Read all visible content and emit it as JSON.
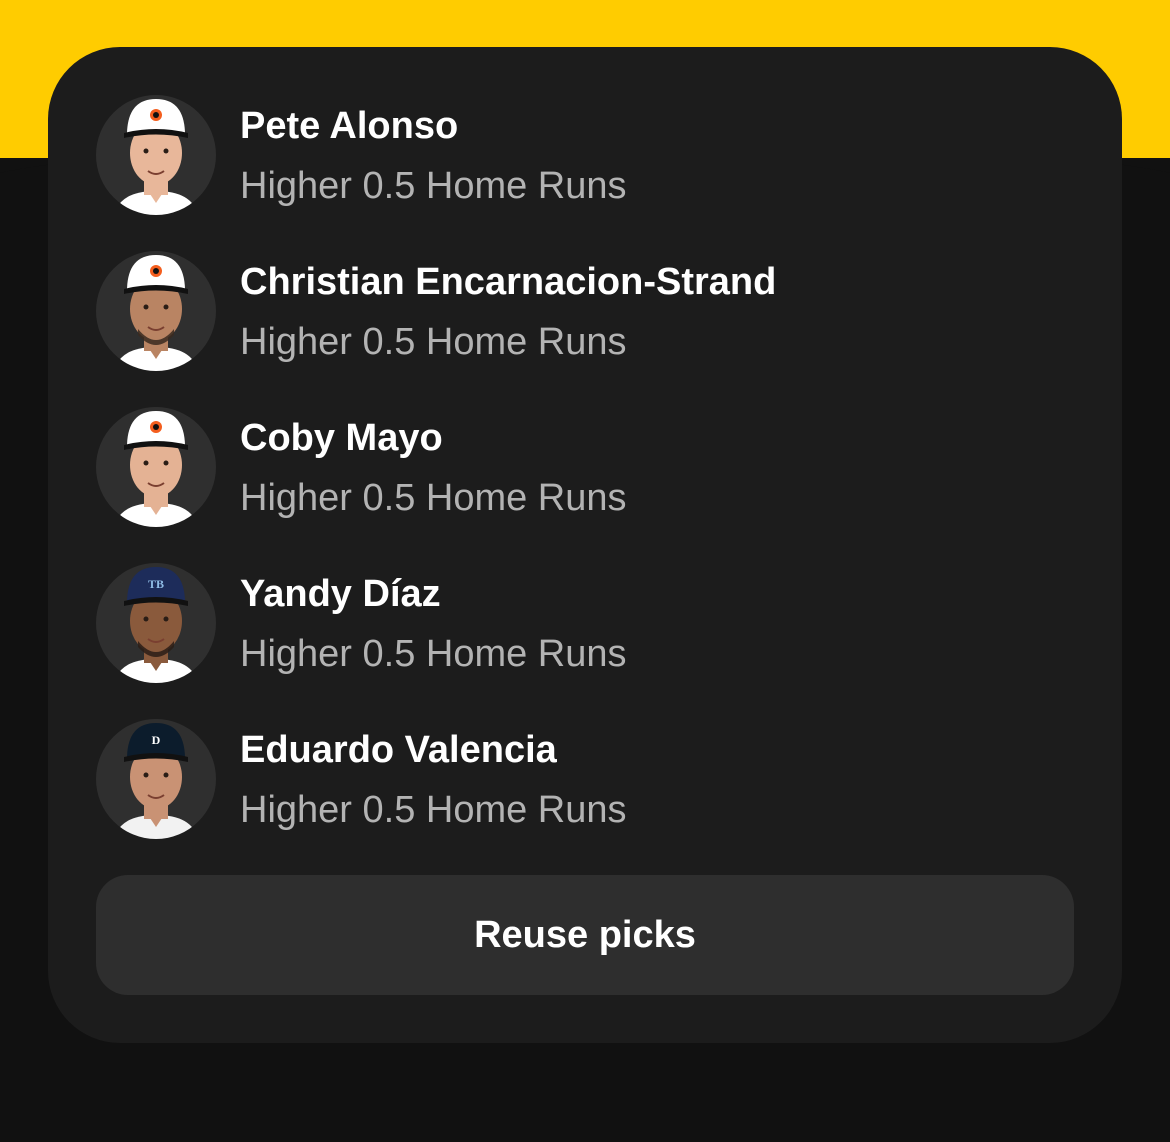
{
  "picks": [
    {
      "name": "Pete Alonso",
      "line": "Higher 0.5 Home Runs",
      "cap_color": "#ffffff",
      "cap_accent": "#f45e1e",
      "skin": "#e8b79a",
      "jersey": "#ffffff",
      "beard": "none",
      "logo": "bird"
    },
    {
      "name": "Christian Encarnacion-Strand",
      "line": "Higher 0.5 Home Runs",
      "cap_color": "#ffffff",
      "cap_accent": "#f45e1e",
      "skin": "#b98463",
      "jersey": "#ffffff",
      "beard": "#3a2a20",
      "logo": "bird"
    },
    {
      "name": "Coby Mayo",
      "line": "Higher 0.5 Home Runs",
      "cap_color": "#ffffff",
      "cap_accent": "#f45e1e",
      "skin": "#e4b294",
      "jersey": "#ffffff",
      "beard": "none",
      "logo": "bird"
    },
    {
      "name": "Yandy Díaz",
      "line": "Higher 0.5 Home Runs",
      "cap_color": "#1d2c5a",
      "cap_accent": "#8fbce6",
      "skin": "#8a5a3c",
      "jersey": "#ffffff",
      "beard": "#2a1d16",
      "logo": "TB"
    },
    {
      "name": "Eduardo Valencia",
      "line": "Higher 0.5 Home Runs",
      "cap_color": "#0c1c2c",
      "cap_accent": "#ffffff",
      "skin": "#c99274",
      "jersey": "#f2f2f2",
      "beard": "none",
      "logo": "D"
    }
  ],
  "reuse_button": {
    "label": "Reuse picks"
  },
  "colors": {
    "band": "#FFCC00",
    "background": "#111111",
    "card": "#1c1c1c",
    "button": "#2e2e2e"
  }
}
